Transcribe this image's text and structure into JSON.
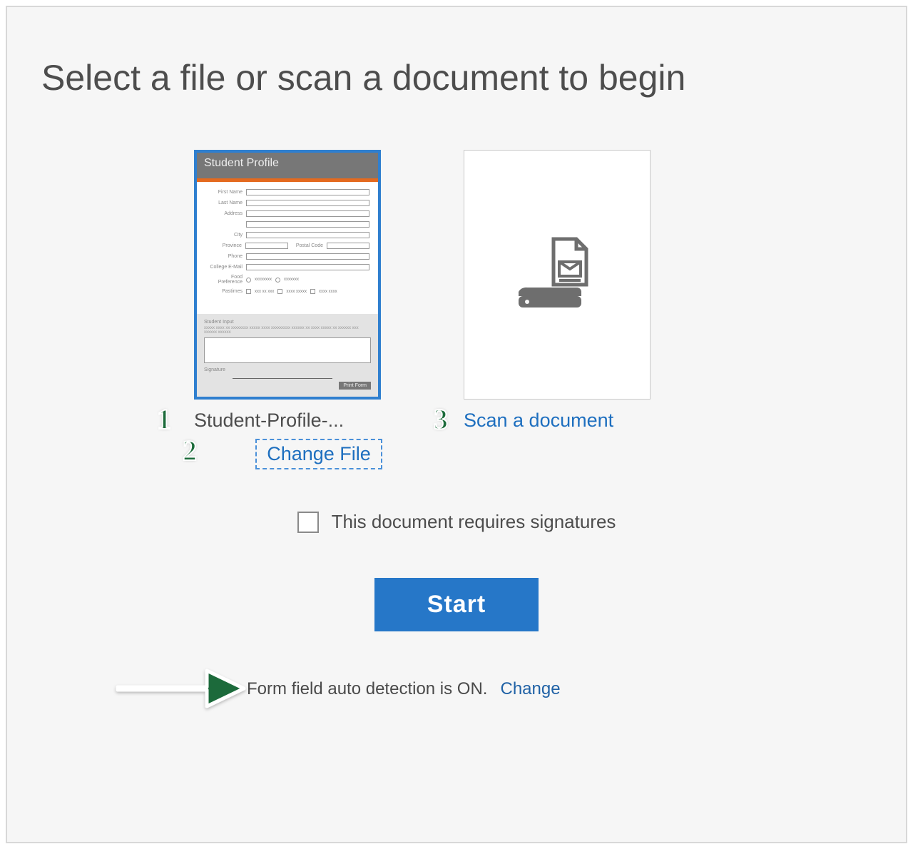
{
  "title": "Select a file or scan a document to begin",
  "file_option": {
    "selected": true,
    "display_name": "Student-Profile-...",
    "change_label": "Change File",
    "preview": {
      "header": "Student Profile",
      "fields": [
        "First Name",
        "Last Name",
        "Address",
        "City",
        "Province",
        "Postal Code",
        "Phone",
        "College E-Mail"
      ],
      "food_pref_label": "Food Preference",
      "pastimes_label": "Pastimes",
      "section_title": "Student Input",
      "print_button": "Print Form",
      "signature_label": "Signature"
    }
  },
  "scan_option": {
    "label": "Scan a document"
  },
  "tutorial_badges": {
    "one": "1",
    "two": "2",
    "three": "3"
  },
  "signatures": {
    "label": "This document requires signatures",
    "checked": false
  },
  "start_button": "Start",
  "detection": {
    "text": "Form field auto detection is ON.",
    "change_label": "Change"
  },
  "colors": {
    "accent": "#2677c8",
    "badge": "#1c6b3a"
  }
}
